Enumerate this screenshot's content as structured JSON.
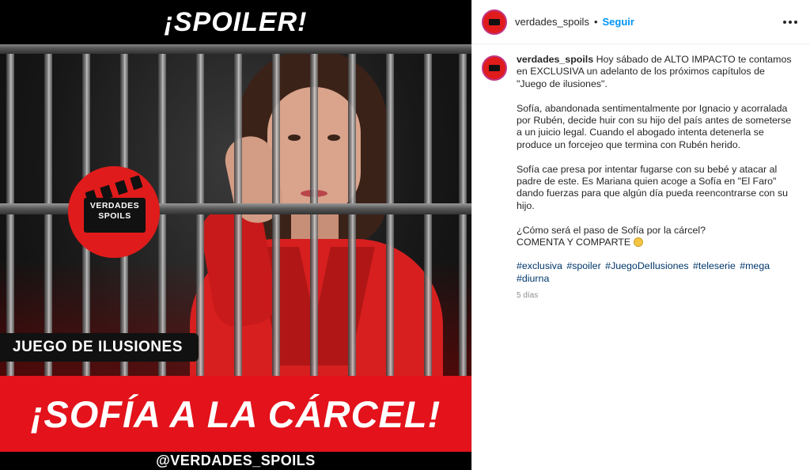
{
  "image": {
    "top_banner": "¡SPOILER!",
    "logo_line1": "VERDADES",
    "logo_line2": "SPOILS",
    "subtitle": "JUEGO DE ILUSIONES",
    "headline": "¡SOFÍA A LA CÁRCEL!",
    "handle": "@VERDADES_SPOILS"
  },
  "header": {
    "username": "verdades_spoils",
    "separator": "•",
    "follow_label": "Seguir"
  },
  "caption": {
    "username": "verdades_spoils",
    "intro": "Hoy sábado de ALTO IMPACTO te contamos en EXCLUSIVA un adelanto de los próximos capítulos de \"Juego de ilusiones\".",
    "para2": "Sofía, abandonada sentimentalmente por Ignacio y acorralada por Rubén, decide huir con su hijo del país antes de someterse a un juicio legal. Cuando el abogado intenta detenerla se produce un forcejeo que termina con Rubén herido.",
    "para3": "Sofía cae presa por intentar fugarse con su bebé y atacar al padre de este. Es Mariana quien acoge a Sofía en \"El Faro\" dando fuerzas para que algún día pueda reencontrarse con su hijo.",
    "question": "¿Cómo será el paso de Sofía por la cárcel?",
    "cta": "COMENTA Y COMPARTE",
    "hashtags": [
      "#exclusiva",
      "#spoiler",
      "#JuegoDeIlusiones",
      "#teleserie",
      "#mega",
      "#diurna"
    ],
    "time_ago": "5 días"
  },
  "colors": {
    "brand_red": "#e3121b",
    "link_blue": "#0095f6",
    "hashtag": "#00376b"
  }
}
